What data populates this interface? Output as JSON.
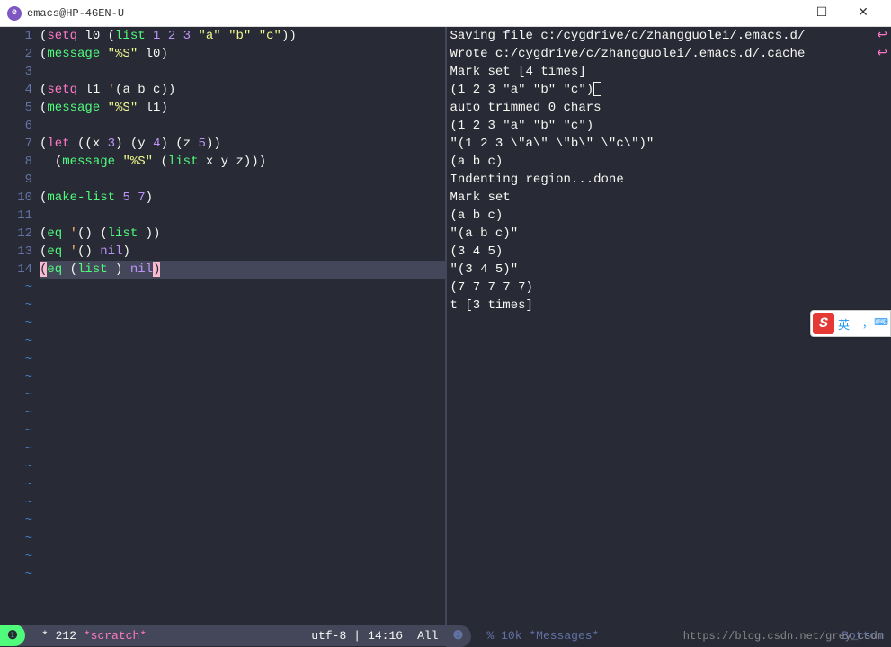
{
  "titlebar": {
    "icon_letter": "e",
    "title": "emacs@HP-4GEN-U",
    "min": "—",
    "max": "☐",
    "close": "✕"
  },
  "left_pane": {
    "lines": [
      {
        "n": 1,
        "tokens": [
          {
            "t": "paren",
            "v": "("
          },
          {
            "t": "kw",
            "v": "setq"
          },
          {
            "t": "sym",
            "v": " l0 "
          },
          {
            "t": "paren",
            "v": "("
          },
          {
            "t": "fn",
            "v": "list"
          },
          {
            "t": "sym",
            "v": " "
          },
          {
            "t": "num",
            "v": "1"
          },
          {
            "t": "sym",
            "v": " "
          },
          {
            "t": "num",
            "v": "2"
          },
          {
            "t": "sym",
            "v": " "
          },
          {
            "t": "num",
            "v": "3"
          },
          {
            "t": "sym",
            "v": " "
          },
          {
            "t": "str",
            "v": "\"a\""
          },
          {
            "t": "sym",
            "v": " "
          },
          {
            "t": "str",
            "v": "\"b\""
          },
          {
            "t": "sym",
            "v": " "
          },
          {
            "t": "str",
            "v": "\"c\""
          },
          {
            "t": "paren",
            "v": "))"
          }
        ]
      },
      {
        "n": 2,
        "tokens": [
          {
            "t": "paren",
            "v": "("
          },
          {
            "t": "fn",
            "v": "message"
          },
          {
            "t": "sym",
            "v": " "
          },
          {
            "t": "str",
            "v": "\"%S\""
          },
          {
            "t": "sym",
            "v": " l0"
          },
          {
            "t": "paren",
            "v": ")"
          }
        ]
      },
      {
        "n": 3,
        "tokens": []
      },
      {
        "n": 4,
        "tokens": [
          {
            "t": "paren",
            "v": "("
          },
          {
            "t": "kw",
            "v": "setq"
          },
          {
            "t": "sym",
            "v": " l1 "
          },
          {
            "t": "quote",
            "v": "'"
          },
          {
            "t": "paren",
            "v": "("
          },
          {
            "t": "sym",
            "v": "a b c"
          },
          {
            "t": "paren",
            "v": "))"
          }
        ]
      },
      {
        "n": 5,
        "tokens": [
          {
            "t": "paren",
            "v": "("
          },
          {
            "t": "fn",
            "v": "message"
          },
          {
            "t": "sym",
            "v": " "
          },
          {
            "t": "str",
            "v": "\"%S\""
          },
          {
            "t": "sym",
            "v": " l1"
          },
          {
            "t": "paren",
            "v": ")"
          }
        ]
      },
      {
        "n": 6,
        "tokens": []
      },
      {
        "n": 7,
        "tokens": [
          {
            "t": "paren",
            "v": "("
          },
          {
            "t": "kw",
            "v": "let"
          },
          {
            "t": "sym",
            "v": " "
          },
          {
            "t": "paren",
            "v": "(("
          },
          {
            "t": "sym",
            "v": "x "
          },
          {
            "t": "num",
            "v": "3"
          },
          {
            "t": "paren",
            "v": ") ("
          },
          {
            "t": "sym",
            "v": "y "
          },
          {
            "t": "num",
            "v": "4"
          },
          {
            "t": "paren",
            "v": ") ("
          },
          {
            "t": "sym",
            "v": "z "
          },
          {
            "t": "num",
            "v": "5"
          },
          {
            "t": "paren",
            "v": "))"
          }
        ]
      },
      {
        "n": 8,
        "tokens": [
          {
            "t": "sym",
            "v": "  "
          },
          {
            "t": "paren",
            "v": "("
          },
          {
            "t": "fn",
            "v": "message"
          },
          {
            "t": "sym",
            "v": " "
          },
          {
            "t": "str",
            "v": "\"%S\""
          },
          {
            "t": "sym",
            "v": " "
          },
          {
            "t": "paren",
            "v": "("
          },
          {
            "t": "fn",
            "v": "list"
          },
          {
            "t": "sym",
            "v": " x y z"
          },
          {
            "t": "paren",
            "v": ")))"
          }
        ]
      },
      {
        "n": 9,
        "tokens": []
      },
      {
        "n": 10,
        "tokens": [
          {
            "t": "paren",
            "v": "("
          },
          {
            "t": "fn",
            "v": "make-list"
          },
          {
            "t": "sym",
            "v": " "
          },
          {
            "t": "num",
            "v": "5"
          },
          {
            "t": "sym",
            "v": " "
          },
          {
            "t": "num",
            "v": "7"
          },
          {
            "t": "paren",
            "v": ")"
          }
        ]
      },
      {
        "n": 11,
        "tokens": []
      },
      {
        "n": 12,
        "tokens": [
          {
            "t": "paren",
            "v": "("
          },
          {
            "t": "fn",
            "v": "eq"
          },
          {
            "t": "sym",
            "v": " "
          },
          {
            "t": "quote",
            "v": "'"
          },
          {
            "t": "paren",
            "v": "() ("
          },
          {
            "t": "fn",
            "v": "list"
          },
          {
            "t": "sym",
            "v": " "
          },
          {
            "t": "paren",
            "v": "))"
          }
        ]
      },
      {
        "n": 13,
        "tokens": [
          {
            "t": "paren",
            "v": "("
          },
          {
            "t": "fn",
            "v": "eq"
          },
          {
            "t": "sym",
            "v": " "
          },
          {
            "t": "quote",
            "v": "'"
          },
          {
            "t": "paren",
            "v": "()"
          },
          {
            "t": "sym",
            "v": " "
          },
          {
            "t": "const",
            "v": "nil"
          },
          {
            "t": "paren",
            "v": ")"
          }
        ]
      },
      {
        "n": 14,
        "hl": true,
        "tokens": [
          {
            "t": "hl-match",
            "v": "("
          },
          {
            "t": "fn",
            "v": "eq"
          },
          {
            "t": "sym",
            "v": " "
          },
          {
            "t": "paren",
            "v": "("
          },
          {
            "t": "fn",
            "v": "list"
          },
          {
            "t": "sym",
            "v": " "
          },
          {
            "t": "paren",
            "v": ")"
          },
          {
            "t": "sym",
            "v": " "
          },
          {
            "t": "const",
            "v": "nil"
          },
          {
            "t": "cursor-block",
            "v": ")"
          }
        ]
      }
    ],
    "tilde_count": 17
  },
  "right_pane": {
    "lines": [
      "Saving file c:/cygdrive/c/zhangguolei/.emacs.d/",
      "Wrote c:/cygdrive/c/zhangguolei/.emacs.d/.cache",
      "Mark set [4 times]",
      "(1 2 3 \"a\" \"b\" \"c\")⎕",
      "auto trimmed 0 chars",
      "(1 2 3 \"a\" \"b\" \"c\")",
      "\"(1 2 3 \\\"a\\\" \\\"b\\\" \\\"c\\\")\"",
      "(a b c)",
      "Indenting region...done",
      "Mark set",
      "(a b c)",
      "\"(a b c)\"",
      "(3 4 5)",
      "\"(3 4 5)\"",
      "(7 7 7 7 7)",
      "t [3 times]"
    ],
    "arrows": [
      true,
      true,
      false,
      false,
      false,
      false,
      false,
      false,
      false,
      false,
      false,
      false,
      false,
      false,
      false,
      false
    ]
  },
  "modeline": {
    "left": {
      "indicator": "❶",
      "modified": "*",
      "size": "212",
      "buffer": "*scratch*",
      "encoding": "utf-8",
      "position": "14:16",
      "scroll": "All"
    },
    "right": {
      "indicator": "❷",
      "pct": "%",
      "size": "10k",
      "buffer": "*Messages*",
      "scroll": "Bottom"
    }
  },
  "ime": {
    "s": "S",
    "lang": "英",
    "punct": "，",
    "kbd": "⌨"
  },
  "watermark": "https://blog.csdn.net/grey_csdn"
}
